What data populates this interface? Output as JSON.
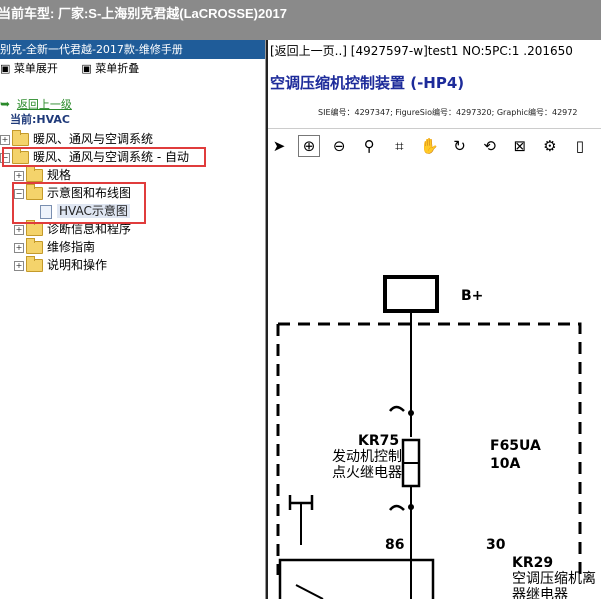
{
  "titlebar": {
    "text": "当前车型:  厂家:S-上海别克君越(LaCROSSE)2017"
  },
  "left": {
    "header": "别克-全新一代君越-2017款-维修手册",
    "expand_label": "菜单展开",
    "collapse_label": "菜单折叠",
    "back_link": "返回上一级",
    "current_label": "当前:HVAC",
    "tree": [
      {
        "label": "暖风、通风与空调系统"
      },
      {
        "label": "暖风、通风与空调系统 - 自动"
      },
      {
        "label": "规格"
      },
      {
        "label": "示意图和布线图"
      },
      {
        "label": "HVAC示意图"
      },
      {
        "label": "诊断信息和程序"
      },
      {
        "label": "维修指南"
      },
      {
        "label": "说明和操作"
      }
    ]
  },
  "right": {
    "path": "[返回上一页..] [4927597-w]test1 NO:5PC:1 .201650",
    "title": "空调压缩机控制装置 (-HP4)",
    "ids": "SIE编号：4297347;  FigureSio编号：4297320;  Graphic编号：42972",
    "toolbar_icons": [
      "pointer-icon",
      "zoom-in-icon",
      "zoom-out-icon",
      "search-icon",
      "crop-icon",
      "hand-icon",
      "rotate-icon",
      "history-icon",
      "fit-icon",
      "settings-icon",
      "page-icon",
      "print-icon",
      "export-icon"
    ]
  },
  "schematic": {
    "b_plus": "B+",
    "kr75_code": "KR75",
    "kr75_line1": "发动机控制",
    "kr75_line2": "点火继电器",
    "f65_code": "F65UA",
    "f65_amp": "10A",
    "pin86": "86",
    "pin30": "30",
    "kr29_code": "KR29",
    "kr29_line1": "空调压缩机离",
    "kr29_line2": "器继电器"
  }
}
